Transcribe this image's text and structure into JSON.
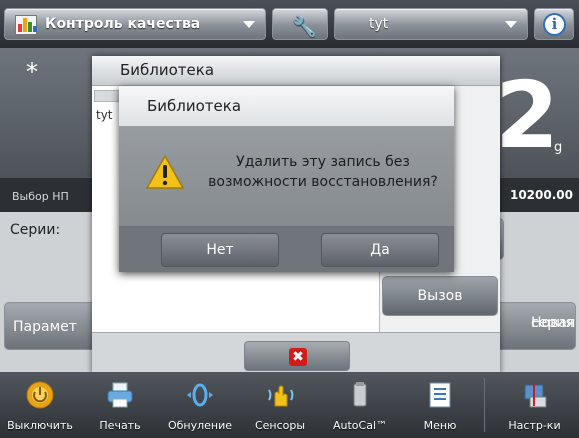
{
  "header": {
    "app_mode": "Контроль качества",
    "user_profile": "tyt"
  },
  "main": {
    "indicator": "*",
    "weight_digit": "2",
    "unit": "g",
    "info_label": "Выбор НП",
    "info_value": "10200.00",
    "series_label": "Серии:",
    "params_button": "Парамет",
    "new_series_button_line1": "Новая",
    "new_series_button_line2": "серия"
  },
  "library": {
    "title": "Библиотека",
    "selected_item": "tyt",
    "recall_button": "Вызов"
  },
  "dialog": {
    "title": "Библиотека",
    "message_line1": "Удалить эту запись без",
    "message_line2": "возможности восстановления?",
    "no_button": "Нет",
    "yes_button": "Да"
  },
  "toolbar": [
    {
      "label": "Выключить",
      "icon": "power-icon"
    },
    {
      "label": "Печать",
      "icon": "printer-icon"
    },
    {
      "label": "Обнуление",
      "icon": "zero-icon"
    },
    {
      "label": "Сенсоры",
      "icon": "hand-sensor-icon"
    },
    {
      "label": "AutoCal™",
      "icon": "calibration-weight-icon"
    },
    {
      "label": "Меню",
      "icon": "menu-icon"
    },
    {
      "label": "Настр-ки",
      "icon": "settings-icon"
    }
  ],
  "colors": {
    "warning_yellow": "#f2c21b",
    "close_red": "#d21b1b",
    "info_blue": "#2f6db7",
    "tool_orange": "#f08a1f"
  }
}
